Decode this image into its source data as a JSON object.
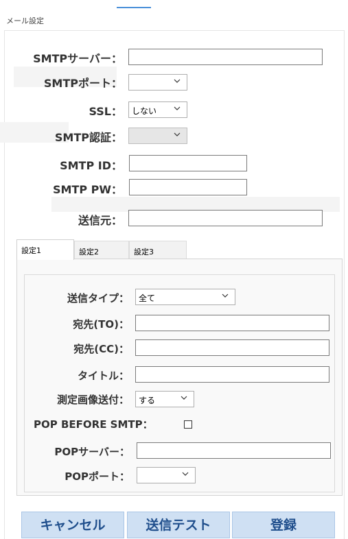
{
  "window": {
    "title": "メール設定"
  },
  "form": {
    "smtp_server": {
      "label": "SMTPサーバー：",
      "value": ""
    },
    "smtp_port": {
      "label": "SMTPポート：",
      "value": ""
    },
    "ssl": {
      "label": "SSL：",
      "value": "しない"
    },
    "smtp_auth": {
      "label": "SMTP認証：",
      "value": ""
    },
    "smtp_id": {
      "label": "SMTP ID：",
      "value": ""
    },
    "smtp_pw": {
      "label": "SMTP PW：",
      "value": ""
    },
    "sender": {
      "label": "送信元：",
      "value": ""
    }
  },
  "tabs": [
    {
      "label": "設定1",
      "active": true
    },
    {
      "label": "設定2",
      "active": false
    },
    {
      "label": "設定3",
      "active": false
    }
  ],
  "tab_content": {
    "send_type": {
      "label": "送信タイプ：",
      "value": "全て"
    },
    "to": {
      "label": "宛先(TO)：",
      "value": ""
    },
    "cc": {
      "label": "宛先(CC)：",
      "value": ""
    },
    "subject": {
      "label": "タイトル：",
      "value": ""
    },
    "send_image": {
      "label": "測定画像送付：",
      "value": "する"
    },
    "pop_before_smtp": {
      "label": "POP BEFORE SMTP：",
      "checked": false
    },
    "pop_server": {
      "label": "POPサーバー：",
      "value": ""
    },
    "pop_port": {
      "label": "POPポート：",
      "value": ""
    }
  },
  "buttons": {
    "cancel": "キャンセル",
    "send_test": "送信テスト",
    "register": "登録"
  },
  "icons": {
    "dropdown": "chevron-down-icon",
    "checkbox": "checkbox-unchecked"
  }
}
